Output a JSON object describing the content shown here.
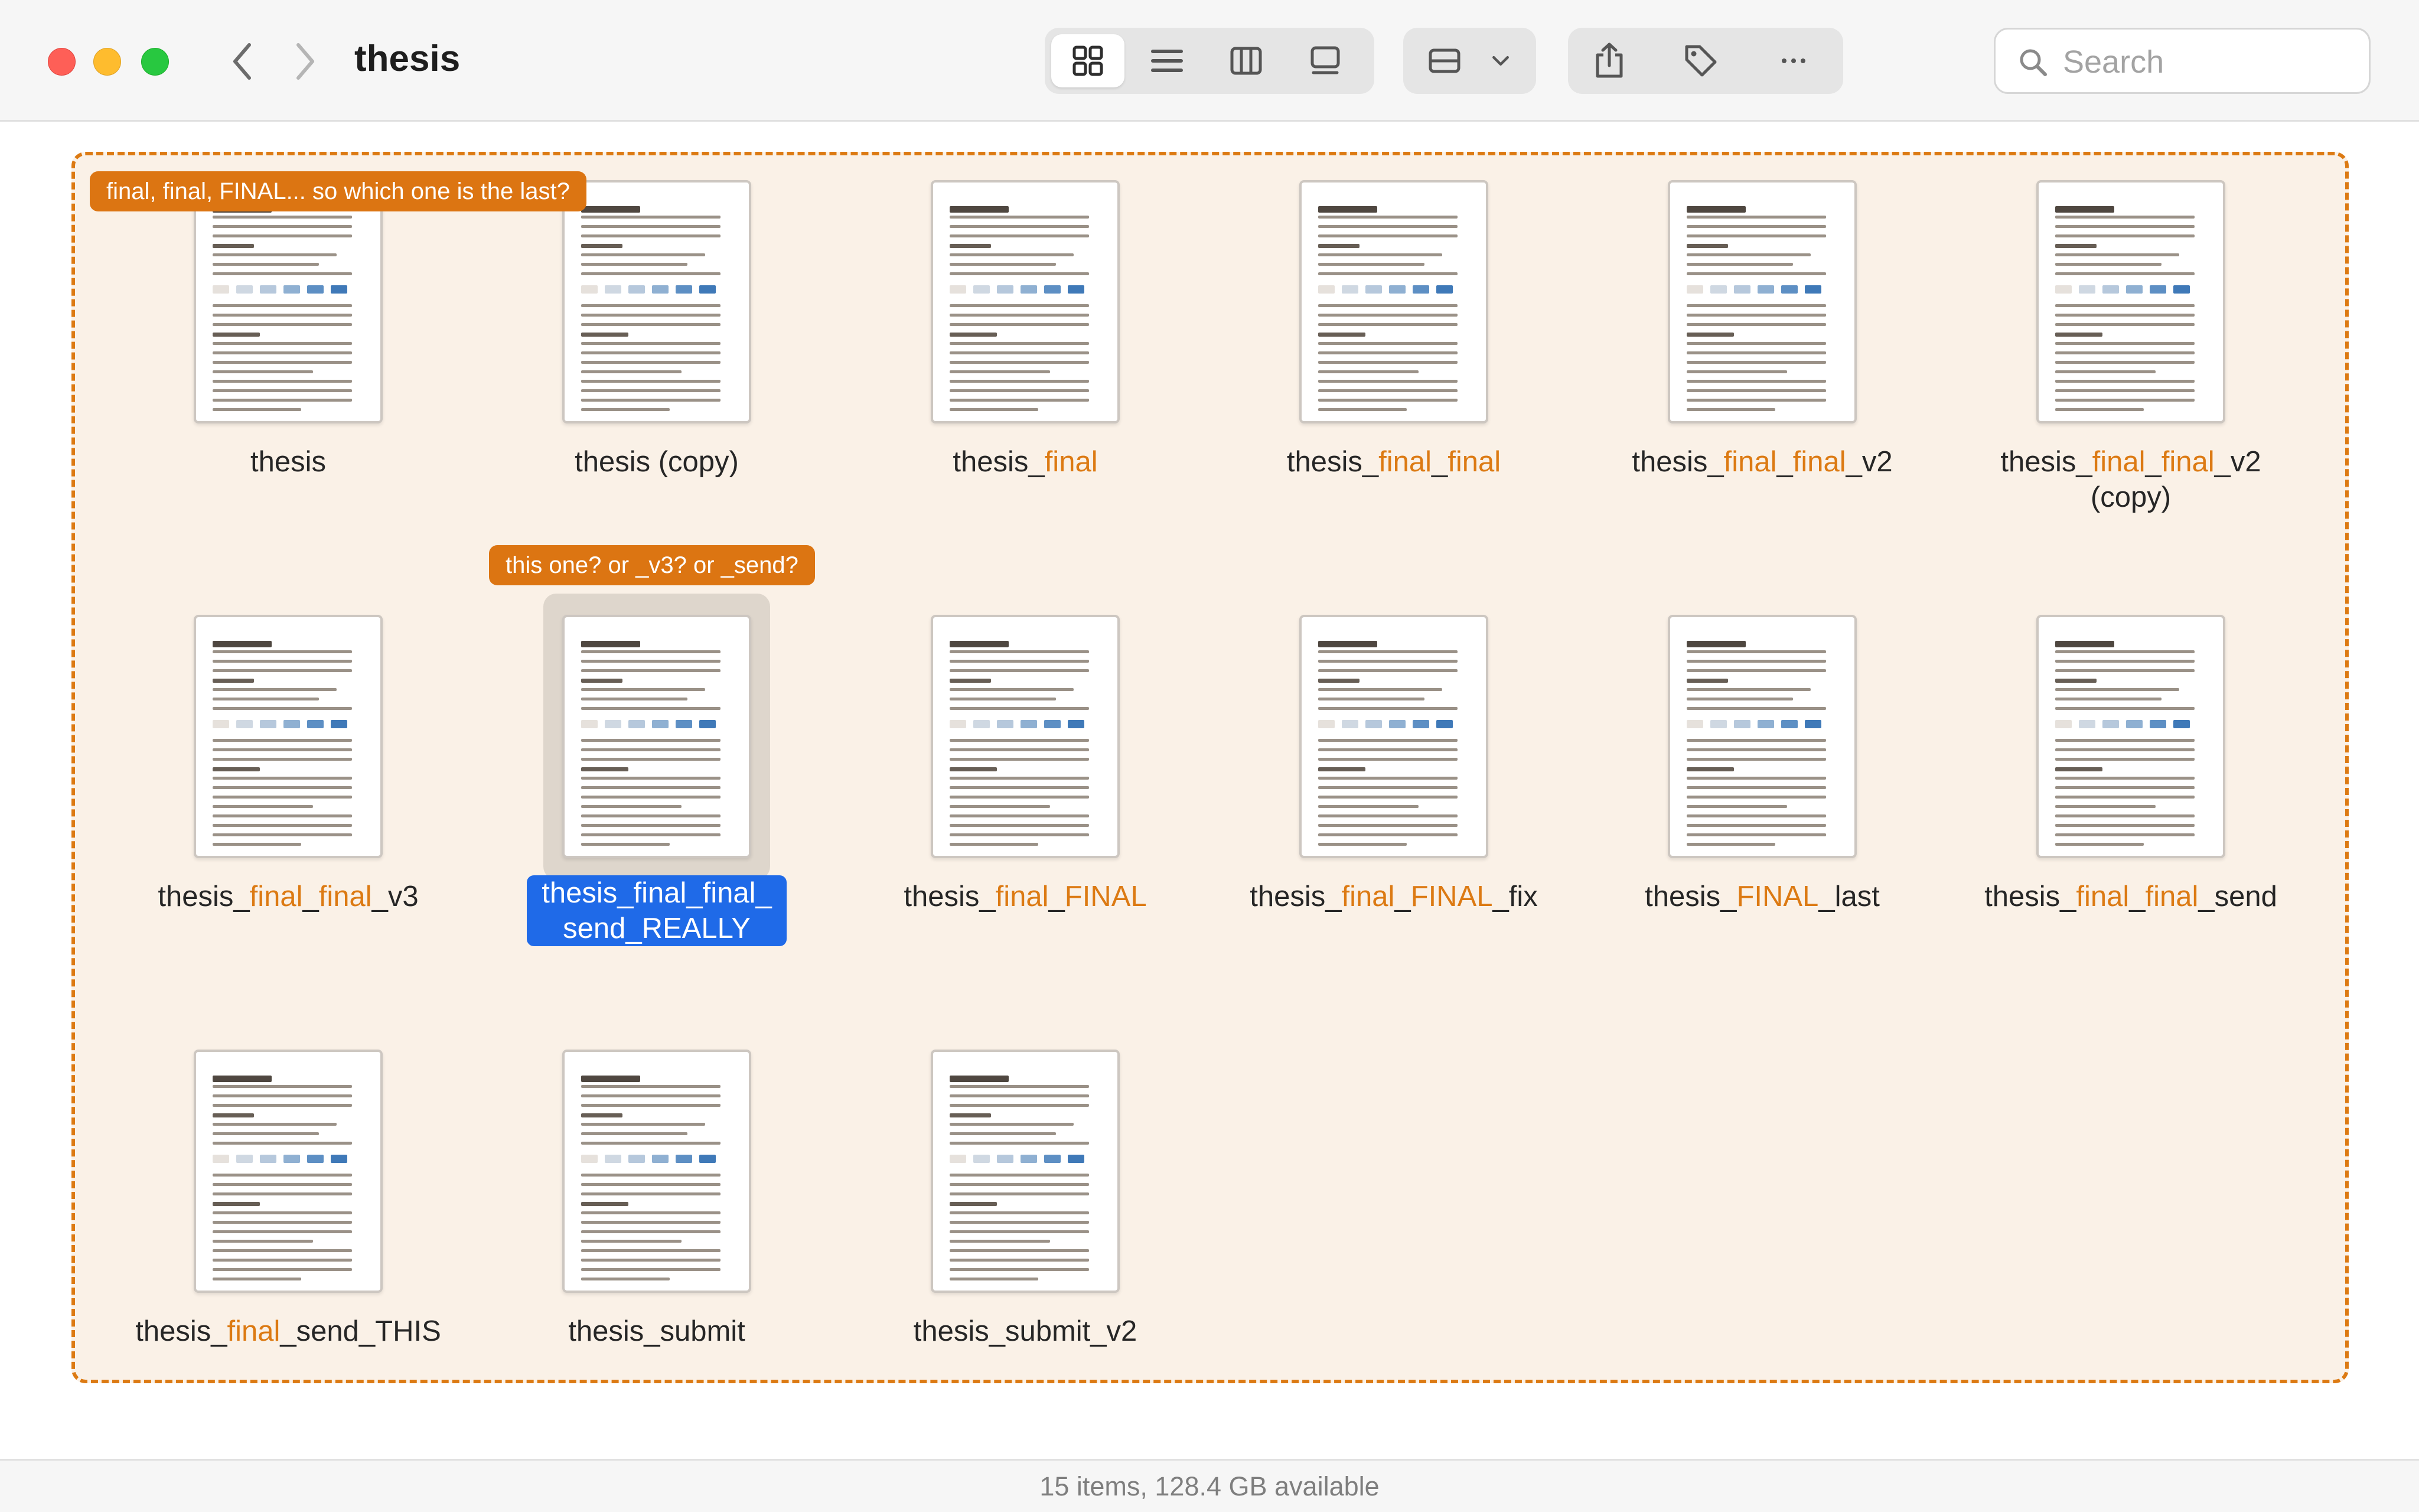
{
  "window": {
    "title": "thesis",
    "controls": [
      "close",
      "minimize",
      "zoom"
    ]
  },
  "toolbar": {
    "back_icon": "chevron-left-icon",
    "forward_icon": "chevron-right-icon",
    "view_modes": [
      {
        "name": "icon-view",
        "icon": "grid-icon",
        "active": true
      },
      {
        "name": "list-view",
        "icon": "list-icon",
        "active": false
      },
      {
        "name": "column-view",
        "icon": "columns-icon",
        "active": false
      },
      {
        "name": "gallery-view",
        "icon": "gallery-icon",
        "active": false
      }
    ],
    "group_icon": "group-by-icon",
    "actions": [
      "share-icon",
      "tag-icon",
      "more-icon"
    ],
    "search": {
      "placeholder": "Search",
      "value": ""
    }
  },
  "colors": {
    "accent": "#dc7a13",
    "selection": "#1f6ae8",
    "note_bg": "#dc7512",
    "panel_bg": "#faf1e7"
  },
  "notes": {
    "top": "final, final, FINAL... so which one is the last?",
    "selected": "this one? or _v3? or _send?"
  },
  "files": [
    {
      "name": "thesis",
      "parts": [
        {
          "t": "thesis",
          "hl": false
        }
      ]
    },
    {
      "name": "thesis (copy)",
      "parts": [
        {
          "t": "thesis (copy)",
          "hl": false
        }
      ]
    },
    {
      "name": "thesis_final",
      "parts": [
        {
          "t": "thesis_",
          "hl": false
        },
        {
          "t": "final",
          "hl": true
        }
      ]
    },
    {
      "name": "thesis_final_final",
      "parts": [
        {
          "t": "thesis_",
          "hl": false
        },
        {
          "t": "final",
          "hl": true
        },
        {
          "t": "_",
          "hl": false
        },
        {
          "t": "final",
          "hl": true
        }
      ]
    },
    {
      "name": "thesis_final_final_v2",
      "parts": [
        {
          "t": "thesis_",
          "hl": false
        },
        {
          "t": "final",
          "hl": true
        },
        {
          "t": "_",
          "hl": false
        },
        {
          "t": "final",
          "hl": true
        },
        {
          "t": "_v2",
          "hl": false
        }
      ]
    },
    {
      "name": "thesis_final_final_v2\n(copy)",
      "parts": [
        {
          "t": "thesis_",
          "hl": false
        },
        {
          "t": "final",
          "hl": true
        },
        {
          "t": "_",
          "hl": false
        },
        {
          "t": "final",
          "hl": true
        },
        {
          "t": "_v2\n(copy)",
          "hl": false
        }
      ]
    },
    {
      "name": "thesis_final_final_v3",
      "parts": [
        {
          "t": "thesis_",
          "hl": false
        },
        {
          "t": "final",
          "hl": true
        },
        {
          "t": "_",
          "hl": false
        },
        {
          "t": "final",
          "hl": true
        },
        {
          "t": "_v3",
          "hl": false
        }
      ]
    },
    {
      "name": "thesis_final_final_\nsend_REALLY",
      "selected": true,
      "parts": [
        {
          "t": "thesis_final_final_\nsend_REALLY",
          "hl": false
        }
      ]
    },
    {
      "name": "thesis_final_FINAL",
      "parts": [
        {
          "t": "thesis_",
          "hl": false
        },
        {
          "t": "final",
          "hl": true
        },
        {
          "t": "_",
          "hl": false
        },
        {
          "t": "FINAL",
          "hl": true
        }
      ]
    },
    {
      "name": "thesis_final_FINAL_fix",
      "parts": [
        {
          "t": "thesis_",
          "hl": false
        },
        {
          "t": "final",
          "hl": true
        },
        {
          "t": "_",
          "hl": false
        },
        {
          "t": "FINAL",
          "hl": true
        },
        {
          "t": "_fix",
          "hl": false
        }
      ]
    },
    {
      "name": "thesis_FINAL_last",
      "parts": [
        {
          "t": "thesis_",
          "hl": false
        },
        {
          "t": "FINAL",
          "hl": true
        },
        {
          "t": "_last",
          "hl": false
        }
      ]
    },
    {
      "name": "thesis_final_final_send",
      "parts": [
        {
          "t": "thesis_",
          "hl": false
        },
        {
          "t": "final",
          "hl": true
        },
        {
          "t": "_",
          "hl": false
        },
        {
          "t": "final",
          "hl": true
        },
        {
          "t": "_send",
          "hl": false
        }
      ]
    },
    {
      "name": "thesis_final_send_THIS",
      "parts": [
        {
          "t": "thesis_",
          "hl": false
        },
        {
          "t": "final",
          "hl": true
        },
        {
          "t": "_send_THIS",
          "hl": false
        }
      ]
    },
    {
      "name": "thesis_submit",
      "parts": [
        {
          "t": "thesis_submit",
          "hl": false
        }
      ]
    },
    {
      "name": "thesis_submit_v2",
      "parts": [
        {
          "t": "thesis_submit_v2",
          "hl": false
        }
      ]
    }
  ],
  "status": {
    "text": "15 items, 128.4 GB available"
  }
}
